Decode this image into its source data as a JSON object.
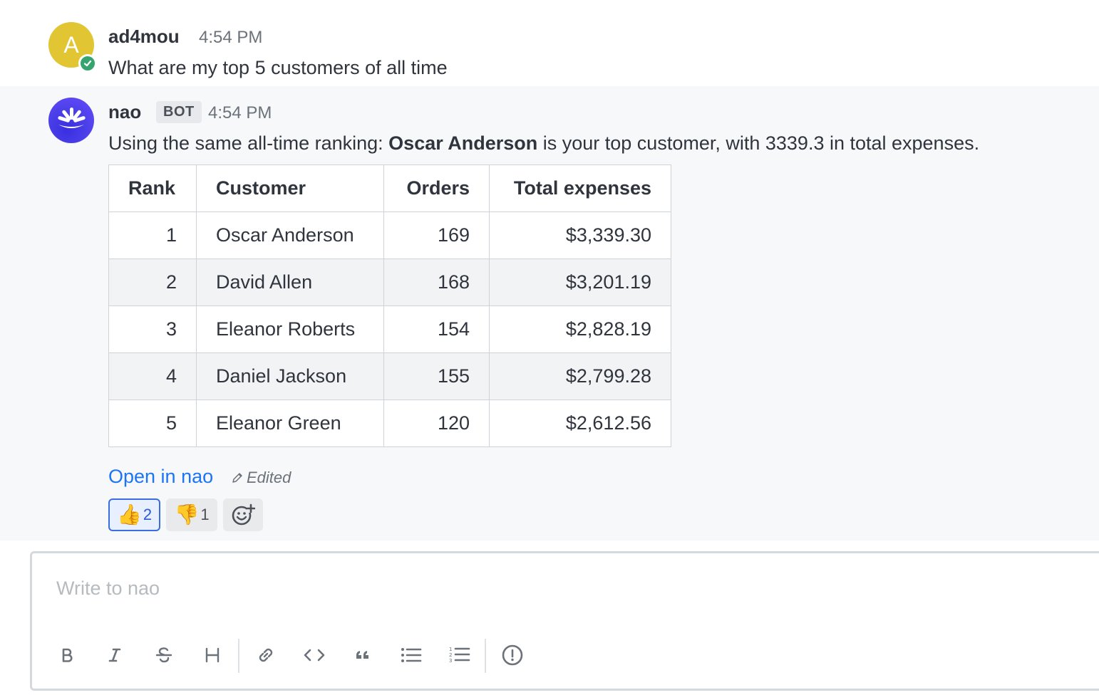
{
  "messages": {
    "user": {
      "avatar_letter": "A",
      "author": "ad4mou",
      "time": "4:54 PM",
      "text": "What are my top 5 customers of all time",
      "avatar_color": "#e1c532",
      "status_color": "#35a46f"
    },
    "bot": {
      "author": "nao",
      "badge": "BOT",
      "time": "4:54 PM",
      "text_before": "Using the same all-time ranking: ",
      "text_bold": "Oscar Anderson",
      "text_after": " is your top customer, with 3339.3 in total expenses.",
      "table": {
        "headers": [
          "Rank",
          "Customer",
          "Orders",
          "Total expenses"
        ],
        "rows": [
          [
            "1",
            "Oscar Anderson",
            "169",
            "$3,339.30"
          ],
          [
            "2",
            "David Allen",
            "168",
            "$3,201.19"
          ],
          [
            "3",
            "Eleanor Roberts",
            "154",
            "$2,828.19"
          ],
          [
            "4",
            "Daniel Jackson",
            "155",
            "$2,799.28"
          ],
          [
            "5",
            "Eleanor Green",
            "120",
            "$2,612.56"
          ]
        ]
      },
      "link": "Open in nao",
      "edited": "Edited",
      "reactions": [
        {
          "emoji": "👍",
          "count": "2",
          "selected": true
        },
        {
          "emoji": "👎",
          "count": "1",
          "selected": false
        }
      ]
    }
  },
  "composer": {
    "placeholder": "Write to nao",
    "toolbar": [
      "bold-icon",
      "italic-icon",
      "strike-icon",
      "heading-icon",
      "link-icon",
      "code-icon",
      "quote-icon",
      "bullet-list-icon",
      "ordered-list-icon",
      "alert-icon"
    ]
  },
  "colors": {
    "accent": "#1d74f5",
    "bot_background": "#f7f8fa"
  }
}
